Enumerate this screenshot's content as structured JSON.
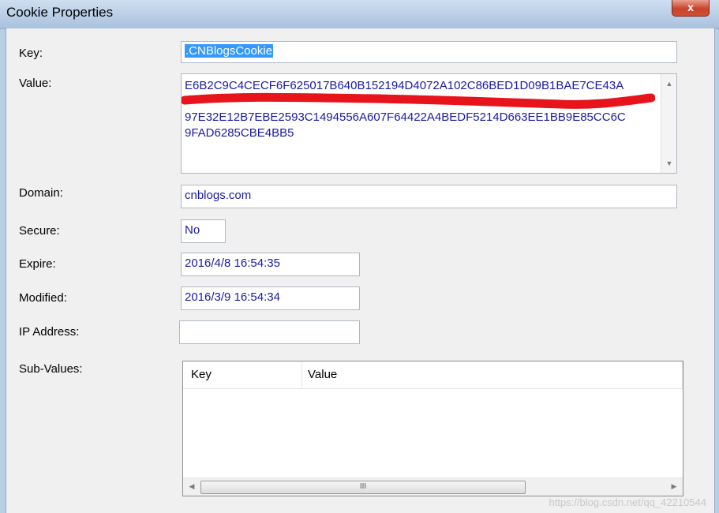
{
  "window": {
    "title": "Cookie Properties",
    "close_glyph": "x"
  },
  "labels": {
    "key": "Key:",
    "value": "Value:",
    "domain": "Domain:",
    "secure": "Secure:",
    "expire": "Expire:",
    "modified": "Modified:",
    "ip_address": "IP Address:",
    "sub_values": "Sub-Values:"
  },
  "fields": {
    "key": ".CNBlogsCookie",
    "value_lines": [
      "E6B2C9C4CECF6F625017B640B152194D4072A102C86BED1D09B1BAE7CE43A",
      "",
      "97E32E12B7EBE2593C1494556A607F64422A4BEDF5214D663EE1BB9E85CC6C",
      "9FAD6285CBE4BB5"
    ],
    "domain": "cnblogs.com",
    "secure": "No",
    "expire": "2016/4/8 16:54:35",
    "modified": "2016/3/9 16:54:34",
    "ip_address": ""
  },
  "sub_values": {
    "columns": [
      "Key",
      "Value"
    ],
    "rows": [],
    "scroll_thumb_glyph": "III"
  },
  "watermark": "https://blog.csdn.net/qq_42210544",
  "colors": {
    "value_text": "#1a1aa6",
    "selection": "#3399ff",
    "redaction": "#e8141b"
  },
  "icons": {
    "close": "close-icon",
    "scroll_up": "scroll-up-icon",
    "scroll_down": "scroll-down-icon",
    "scroll_left": "scroll-left-icon",
    "scroll_right": "scroll-right-icon"
  }
}
